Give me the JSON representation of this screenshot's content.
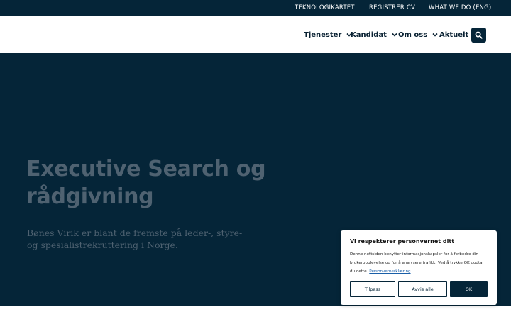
{
  "topbar": {
    "links": [
      "TEKNOLOGIKARTET",
      "REGISTRER CV",
      "WHAT WE DO (ENG)"
    ]
  },
  "nav": {
    "items": [
      {
        "label": "Tjenester",
        "icon": "chevron-down-icon"
      },
      {
        "label": "Kandidat",
        "icon": "chevron-down-icon"
      },
      {
        "label": "Om oss",
        "icon": "chevron-down-icon"
      },
      {
        "label": "Aktuelt"
      }
    ],
    "search_icon": "search-icon"
  },
  "hero": {
    "title": "Executive Search og rådgivning",
    "subtitle": "Bønes Virik er blant de fremste på leder-, styre- og spesialistrekruttering i Norge."
  },
  "cookie": {
    "title": "Vi respekterer personvernet ditt",
    "body": "Denne nettsiden benytter informasjonskapsler for å forbedre din brukeropplevelse og for å analysere trafikk. Ved å trykke OK godtar du dette.",
    "link": "Personvernerklæring",
    "buttons": {
      "customize": "Tilpass",
      "reject": "Avvis alle",
      "accept": "OK"
    }
  },
  "colors": {
    "navy": "#052538",
    "hero_text": "#4f6271",
    "white": "#ffffff"
  }
}
